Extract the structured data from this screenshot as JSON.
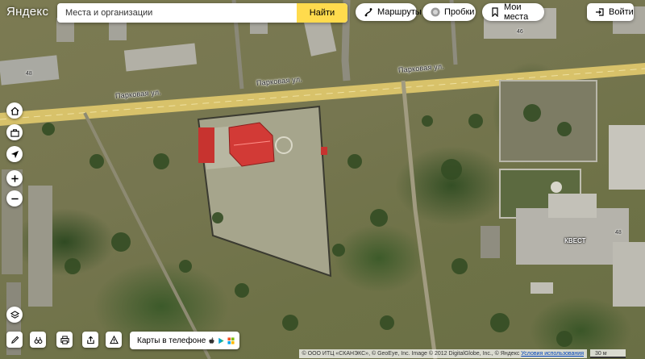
{
  "header": {
    "logo": "Яндекс",
    "search_placeholder": "Места и организации",
    "search_button": "Найти",
    "routes": "Маршруты",
    "traffic": "Пробки",
    "my_places": "Мои места",
    "login": "Войти"
  },
  "map": {
    "streets": [
      {
        "text": "Парковая ул."
      },
      {
        "text": "Парковая ул."
      },
      {
        "text": "Парковая ул."
      }
    ],
    "house_numbers": [
      "48",
      "46",
      "48"
    ],
    "building_labels": [
      "КВЕСТ"
    ]
  },
  "footer": {
    "phone_button": "Карты в телефоне",
    "copyright": "© ООО ИТЦ «СКАНЭКС», © GeoEye, Inc. Image © 2012 DigitalGlobe, Inc., © Яндекс",
    "terms_link": "Условия использования",
    "scale": "30 м"
  },
  "colors": {
    "search_button": "#ffdb4d",
    "road": "#d8c26a",
    "roof": "#d23a36"
  }
}
